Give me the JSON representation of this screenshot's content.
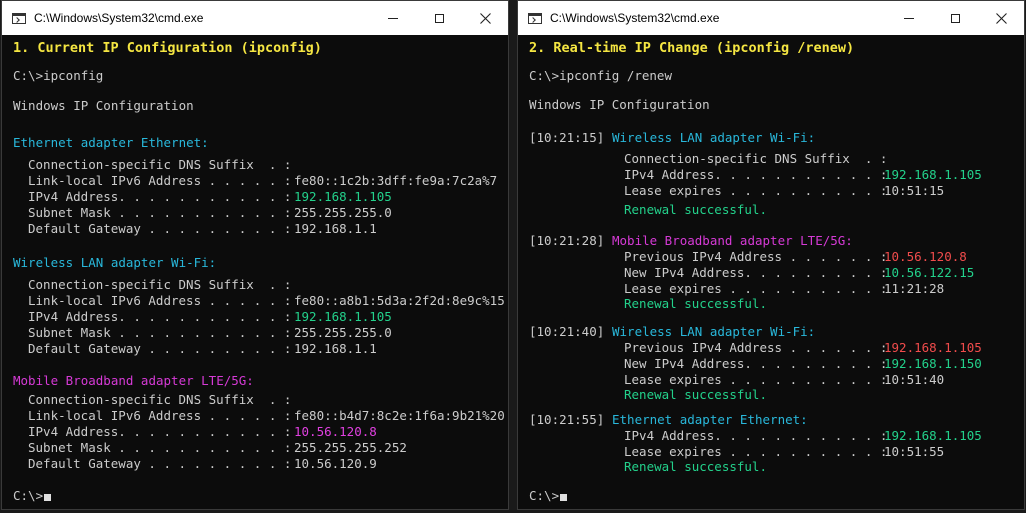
{
  "left": {
    "title": "C:\\Windows\\System32\\cmd.exe",
    "heading": "1. Current IP Configuration (ipconfig)",
    "prompt_cmd": "C:\\>ipconfig",
    "win_ip_config": "Windows IP Configuration",
    "adapters": [
      {
        "name": "Ethernet adapter Ethernet:",
        "dns": "Connection-specific DNS Suffix  . :",
        "ll_label": "Link-local IPv6 Address . . . . . :",
        "ll_value": "fe80::1c2b:3dff:fe9a:7c2a%7",
        "ipv4_label": "IPv4 Address. . . . . . . . . . . :",
        "ipv4_value": "192.168.1.105",
        "mask_label": "Subnet Mask . . . . . . . . . . . :",
        "mask_value": "255.255.255.0",
        "gw_label": "Default Gateway . . . . . . . . . :",
        "gw_value": "192.168.1.1"
      },
      {
        "name": "Wireless LAN adapter Wi-Fi:",
        "dns": "Connection-specific DNS Suffix  . :",
        "ll_label": "Link-local IPv6 Address . . . . . :",
        "ll_value": "fe80::a8b1:5d3a:2f2d:8e9c%15",
        "ipv4_label": "IPv4 Address. . . . . . . . . . . :",
        "ipv4_value": "192.168.1.105",
        "mask_label": "Subnet Mask . . . . . . . . . . . :",
        "mask_value": "255.255.255.0",
        "gw_label": "Default Gateway . . . . . . . . . :",
        "gw_value": "192.168.1.1"
      },
      {
        "name": "Mobile Broadband adapter LTE/5G:",
        "dns": "Connection-specific DNS Suffix  . :",
        "ll_label": "Link-local IPv6 Address . . . . . :",
        "ll_value": "fe80::b4d7:8c2e:1f6a:9b21%20",
        "ipv4_label": "IPv4 Address. . . . . . . . . . . :",
        "ipv4_value": "10.56.120.8",
        "mask_label": "Subnet Mask . . . . . . . . . . . :",
        "mask_value": "255.255.255.252",
        "gw_label": "Default Gateway . . . . . . . . . :",
        "gw_value": "10.56.120.9"
      }
    ],
    "prompt_end": "C:\\>"
  },
  "right": {
    "title": "C:\\Windows\\System32\\cmd.exe",
    "heading": "2. Real-time IP Change (ipconfig /renew)",
    "prompt_cmd": "C:\\>ipconfig /renew",
    "win_ip_config": "Windows IP Configuration",
    "events": [
      {
        "time": "[10:21:15]",
        "adapter": "Wireless LAN adapter Wi-Fi:",
        "l1": "Connection-specific DNS Suffix  . :",
        "l2_label": "IPv4 Address. . . . . . . . . . . :",
        "l2_value": "192.168.1.105",
        "l3_label": "Lease expires . . . . . . . . . . :",
        "l3_value": "10:51:15",
        "status": "Renewal successful."
      },
      {
        "time": "[10:21:28]",
        "adapter": "Mobile Broadband adapter LTE/5G:",
        "l1_label": "Previous IPv4 Address . . . . . . :",
        "l1_value": "10.56.120.8",
        "l2_label": "New IPv4 Address. . . . . . . . . :",
        "l2_value": "10.56.122.15",
        "l3_label": "Lease expires . . . . . . . . . . :",
        "l3_value": "11:21:28",
        "status": "Renewal successful."
      },
      {
        "time": "[10:21:40]",
        "adapter": "Wireless LAN adapter Wi-Fi:",
        "l1_label": "Previous IPv4 Address . . . . . . :",
        "l1_value": "192.168.1.105",
        "l2_label": "New IPv4 Address. . . . . . . . . :",
        "l2_value": "192.168.1.150",
        "l3_label": "Lease expires . . . . . . . . . . :",
        "l3_value": "10:51:40",
        "status": "Renewal successful."
      },
      {
        "time": "[10:21:55]",
        "adapter": "Ethernet adapter Ethernet:",
        "l2_label": "IPv4 Address. . . . . . . . . . . :",
        "l2_value": "192.168.1.105",
        "l3_label": "Lease expires . . . . . . . . . . :",
        "l3_value": "10:51:55",
        "status": "Renewal successful."
      }
    ],
    "prompt_end": "C:\\>"
  },
  "colors": {
    "heading": "#f5e642",
    "adapter_cyan": "#29b8db",
    "adapter_magenta": "#d63ad6",
    "ok_green": "#23d18b",
    "old_red": "#f14c4c"
  }
}
